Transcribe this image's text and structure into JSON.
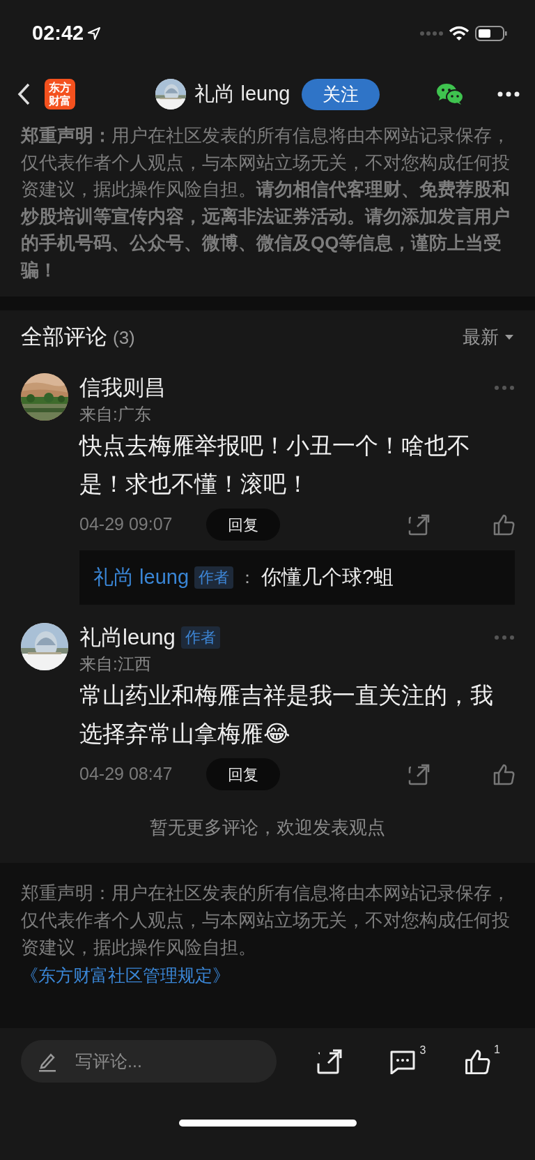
{
  "status_bar": {
    "time": "02:42"
  },
  "nav": {
    "logo_lines": [
      "东方",
      "财富"
    ],
    "user": "礼尚 leung",
    "follow_button": "关注"
  },
  "top_disclaimer": "**郑重声明：**用户在社区发表的所有信息将由本网站记录保存，仅代表作者个人观点，与本网站立场无关，不对您构成任何投资建议，据此操作风险自担。**请勿相信代客理财、免费荐股和炒股培训等宣传内容，远离非法证券活动。请勿添加发言用户的手机号码、公众号、微博、微信及QQ等信息，谨防上当受骗！**",
  "comments_header": {
    "title": "全部评论",
    "count": "(3)",
    "sort": "最新"
  },
  "comments": [
    {
      "avatar": {
        "kind": "picture"
      },
      "name": "信我则昌",
      "location": "来自:广东",
      "text": "快点去梅雁举报吧！小丑一个！啥也不是！求也不懂！滚吧！",
      "time": "04-29 09:07",
      "reply_button": "回复",
      "replies": [
        {
          "name": "礼尚 leung",
          "badge": "作者",
          "separator": "：",
          "text": "你懂几个球?蛆"
        }
      ]
    },
    {
      "avatar": {
        "kind": "picture"
      },
      "name": "礼尚leung",
      "badge": "作者",
      "location": "来自:江西",
      "text": "常山药业和梅雁吉祥是我一直关注的，我选择弃常山拿梅雁😂",
      "time": "04-29 08:47",
      "reply_button": "回复"
    }
  ],
  "no_more": "暂无更多评论，欢迎发表观点",
  "footer": {
    "disclaimer": "郑重声明：用户在社区发表的所有信息将由本网站记录保存，仅代表作者个人观点，与本网站立场无关，不对您构成任何投资建议，据此操作风险自担。",
    "rules_link": "《东方财富社区管理规定》"
  },
  "bottom_bar": {
    "placeholder": "写评论...",
    "comment_count": "3",
    "like_count": "1"
  }
}
